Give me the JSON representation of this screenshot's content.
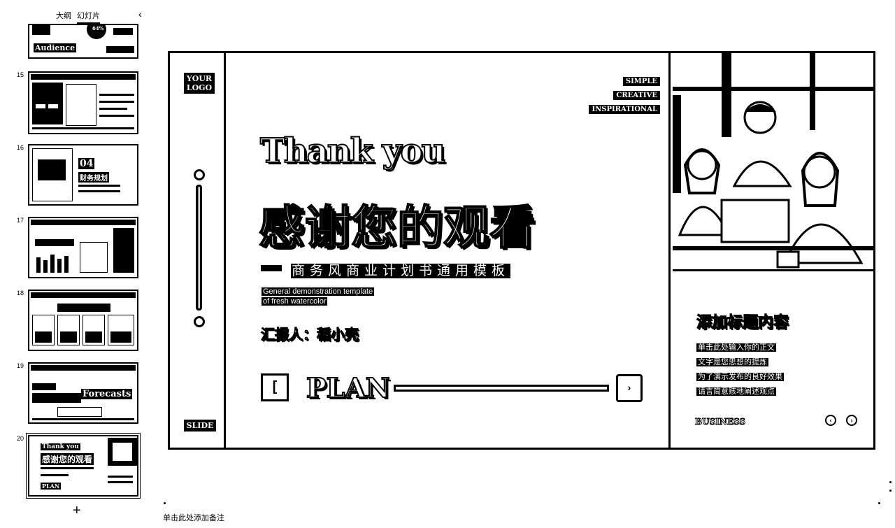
{
  "panel": {
    "tabs": [
      {
        "label": "大纲",
        "active": false
      },
      {
        "label": "幻灯片",
        "active": true
      }
    ],
    "collapse_icon": "chevron-left-icon",
    "add_slide_icon": "plus-icon"
  },
  "thumbnails": [
    {
      "number": "",
      "caption": "Audience",
      "percent": "64%"
    },
    {
      "number": "15",
      "caption": ""
    },
    {
      "number": "16",
      "caption": "04",
      "subcaption": "财务规划"
    },
    {
      "number": "17",
      "caption": ""
    },
    {
      "number": "18",
      "caption": ""
    },
    {
      "number": "19",
      "caption": "Forecasts"
    },
    {
      "number": "20",
      "caption": "Thank you",
      "subcaption": "感谢您的观看",
      "plan": "PLAN"
    }
  ],
  "slide": {
    "logo": "YOUR LOGO",
    "footer_tag": "SLIDE",
    "tags": [
      "SIMPLE",
      "CREATIVE",
      "INSPIRATIONAL"
    ],
    "title_en": "Thank you",
    "title_zh": "感谢您的观看",
    "subtitle_zh": "商务风商业计划书通用模板",
    "subtitle_en_1": "General demonstration template",
    "subtitle_en_2": "of fresh watercolor",
    "reporter": "汇报人：稻小壳",
    "plan_label": "PLAN",
    "prev_icon": "chevron-left-icon",
    "next_icon": "chevron-right-icon",
    "info": {
      "title": "添加标题内容",
      "lines": [
        "单击此处输入你的正文",
        "文字是您思想的提炼",
        "为了演示发布的良好效果",
        "请言简意赅地阐述观点"
      ],
      "tag": "BUSINESS"
    }
  },
  "notes_placeholder": "单击此处添加备注"
}
